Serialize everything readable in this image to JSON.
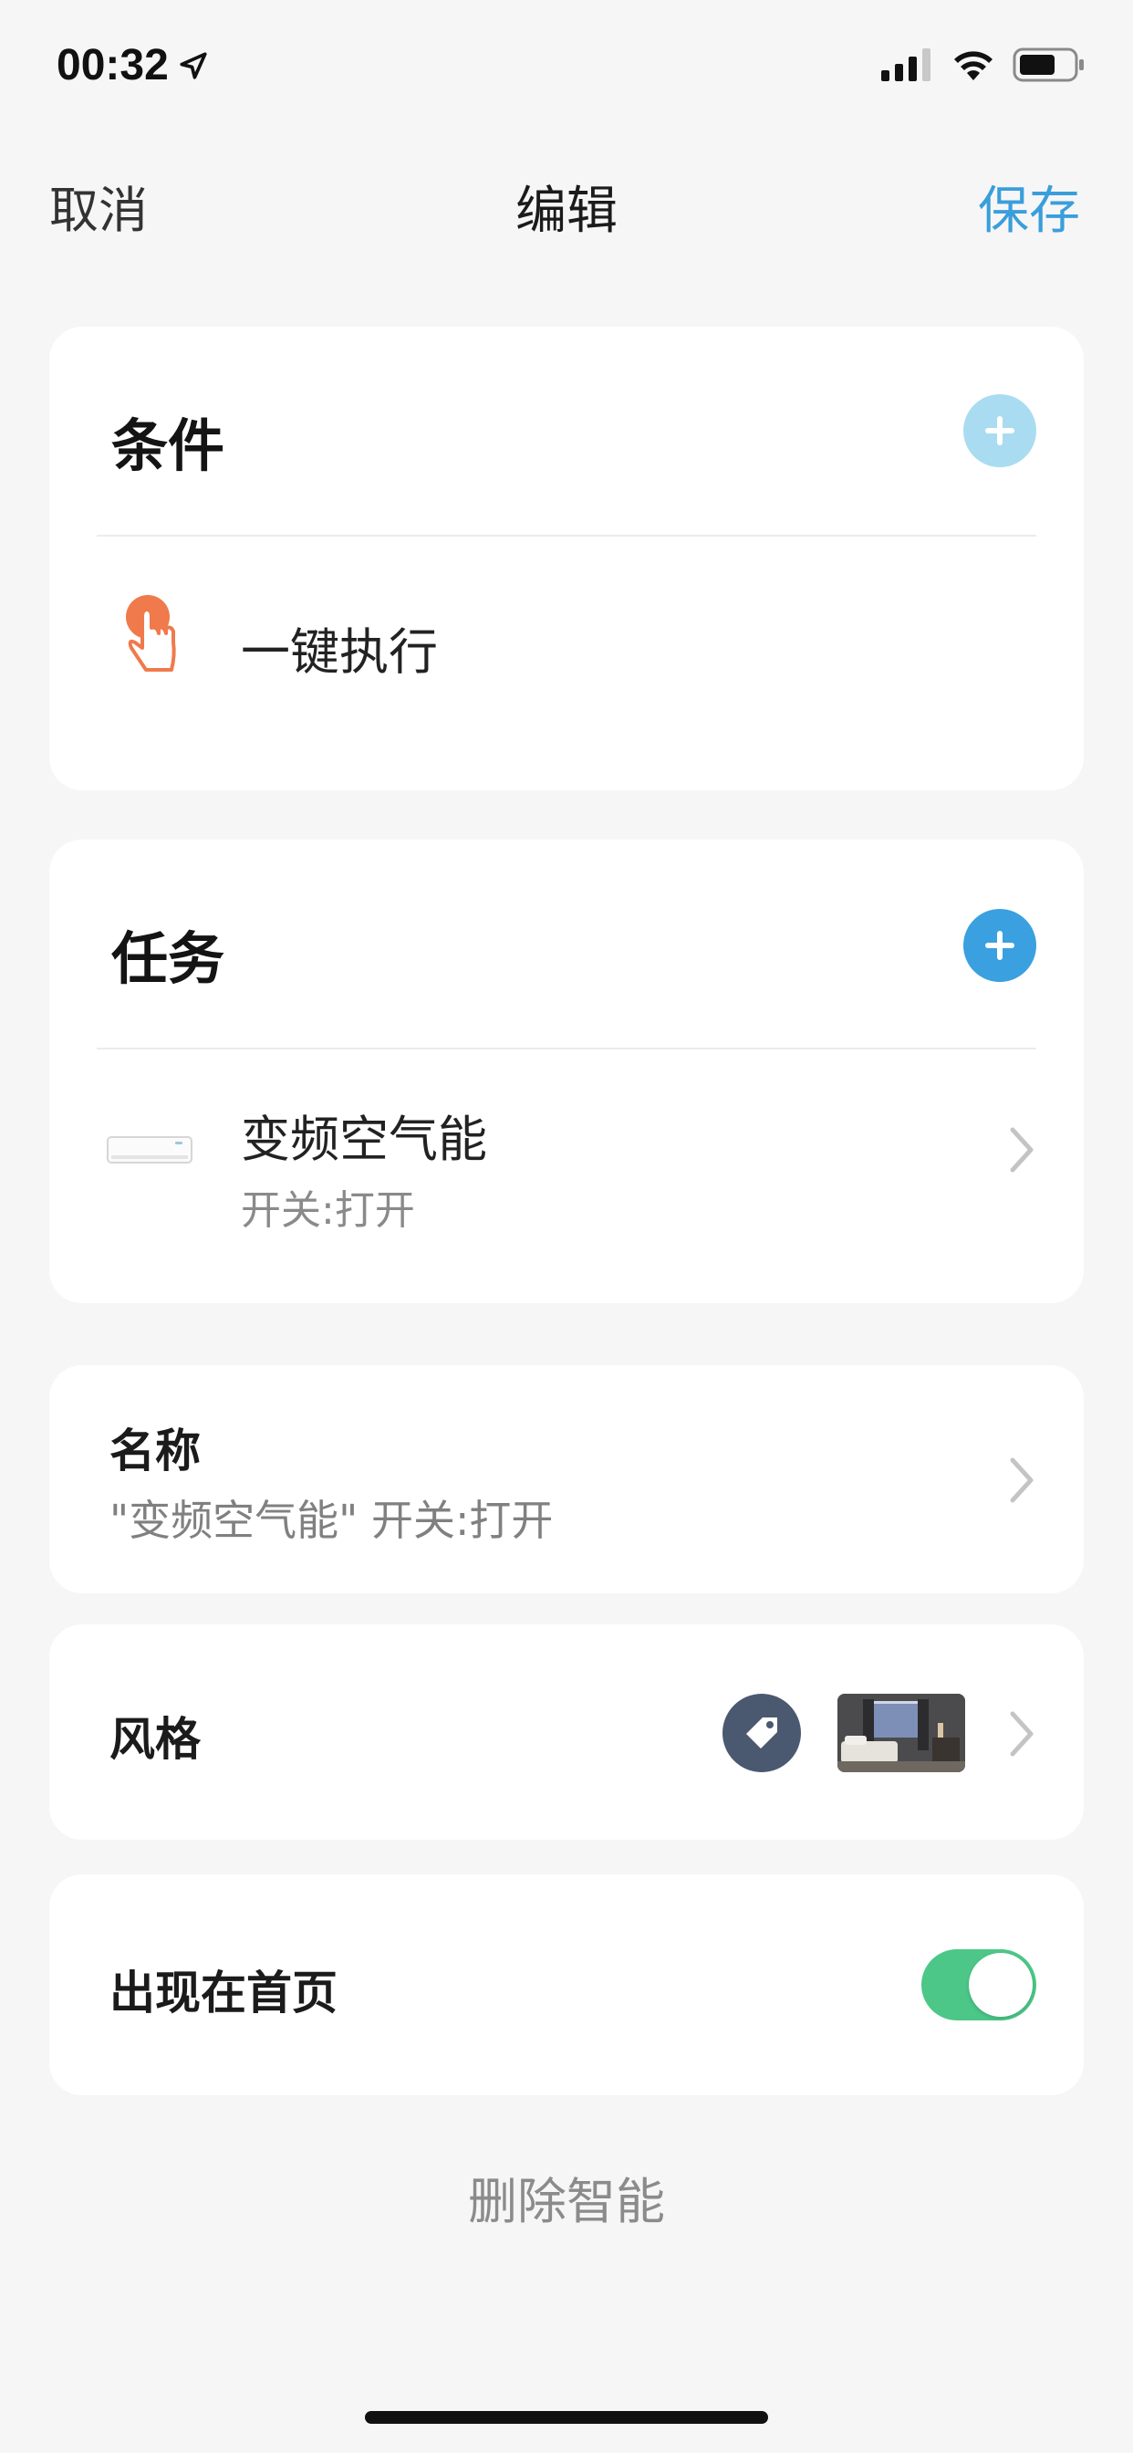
{
  "status_bar": {
    "time": "00:32",
    "icons": [
      "location-arrow-icon",
      "signal-icon",
      "wifi-icon",
      "battery-icon"
    ]
  },
  "nav": {
    "cancel": "取消",
    "title": "编辑",
    "save": "保存"
  },
  "conditions": {
    "title": "条件",
    "add_icon": "plus-icon",
    "items": [
      {
        "icon": "tap-hand-icon",
        "label": "一键执行"
      }
    ]
  },
  "tasks": {
    "title": "任务",
    "add_icon": "plus-icon",
    "items": [
      {
        "icon": "air-conditioner-icon",
        "title": "变频空气能",
        "subtitle": "开关:打开"
      }
    ]
  },
  "name_row": {
    "label": "名称",
    "value": "\"变频空气能\" 开关:打开"
  },
  "style_row": {
    "label": "风格",
    "icons": [
      "tag-icon",
      "bedroom-thumbnail"
    ]
  },
  "homepage_row": {
    "label": "出现在首页",
    "toggle_on": true
  },
  "delete": {
    "label": "删除智能"
  },
  "colors": {
    "accent": "#3a9edb",
    "add_light": "#a9dcf1",
    "add_dark": "#3aa0e0",
    "toggle_on": "#4cc787",
    "tap_icon": "#f07a4b",
    "tag_bg": "#4a5970"
  }
}
